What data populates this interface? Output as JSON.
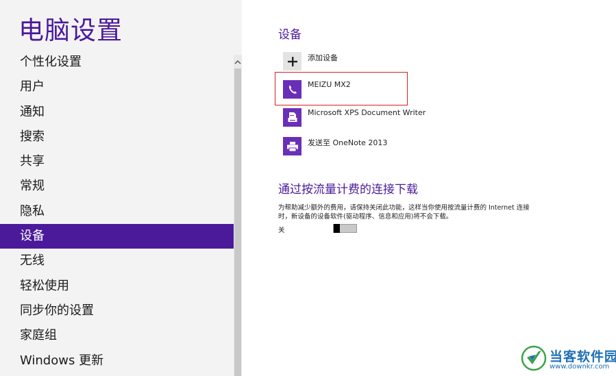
{
  "app": {
    "title": "电脑设置"
  },
  "sidebar": {
    "items": [
      {
        "label": "个性化设置"
      },
      {
        "label": "用户"
      },
      {
        "label": "通知"
      },
      {
        "label": "搜索"
      },
      {
        "label": "共享"
      },
      {
        "label": "常规"
      },
      {
        "label": "隐私"
      },
      {
        "label": "设备",
        "selected": true
      },
      {
        "label": "无线"
      },
      {
        "label": "轻松使用"
      },
      {
        "label": "同步你的设置"
      },
      {
        "label": "家庭组"
      },
      {
        "label": "Windows 更新"
      }
    ]
  },
  "devices": {
    "title": "设备",
    "add_label": "添加设备",
    "list": [
      {
        "label": "MEIZU MX2",
        "icon": "phone-icon"
      },
      {
        "label": "Microsoft XPS Document Writer",
        "icon": "document-printer-icon"
      },
      {
        "label": "发送至 OneNote 2013",
        "icon": "printer-icon"
      }
    ]
  },
  "metered": {
    "title": "通过按流量计费的连接下载",
    "description": "为帮助减少额外的费用，请保持关闭此功能，这样当你使用按流量计费的 Internet 连接时，新设备的设备软件(驱动程序、信息和应用)将不会下载。",
    "toggle_label": "关",
    "toggle_on": false
  },
  "watermark": {
    "name": "当客软件园",
    "url": "www.downkr.com"
  },
  "colors": {
    "accent": "#4b1a9a",
    "icon_tile": "#6a2fb8",
    "highlight": "#d42020",
    "sidebar_bg": "#f3f3f3"
  }
}
